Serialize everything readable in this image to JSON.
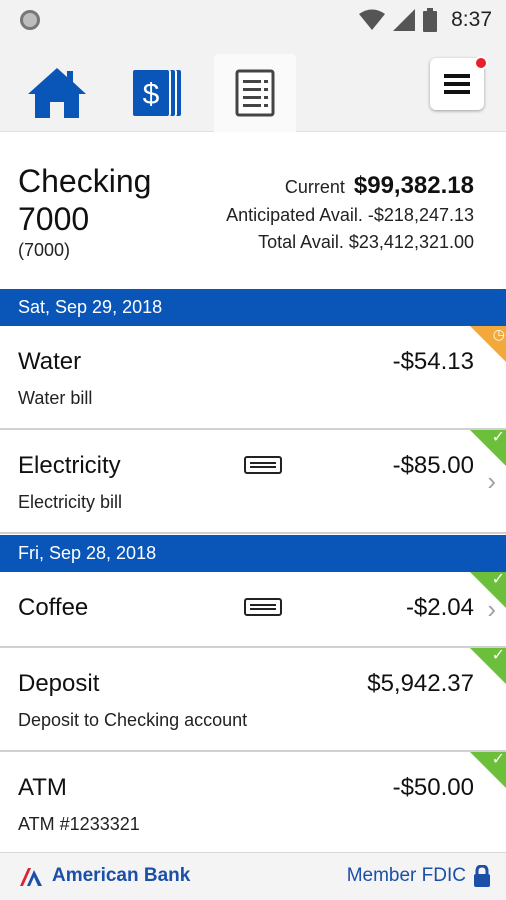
{
  "status_bar": {
    "time": "8:37"
  },
  "nav": {
    "tabs": [
      {
        "icon": "home-icon",
        "active": false
      },
      {
        "icon": "dollar-icon",
        "active": false
      },
      {
        "icon": "statement-icon",
        "active": true
      }
    ],
    "menu": {
      "icon": "hamburger-icon",
      "has_notification": true
    }
  },
  "account": {
    "name": "Checking 7000",
    "number": "(7000)",
    "current_label": "Current",
    "current_value": "$99,382.18",
    "anticipated_label": "Anticipated Avail.",
    "anticipated_value": "-$218,247.13",
    "total_label": "Total Avail.",
    "total_value": "$23,412,321.00"
  },
  "groups": [
    {
      "date": "Sat, Sep 29, 2018",
      "transactions": [
        {
          "title": "Water",
          "amount": "-$54.13",
          "description": "Water bill",
          "status": "pending"
        },
        {
          "title": "Electricity",
          "amount": "-$85.00",
          "description": "Electricity bill",
          "status": "cleared",
          "card": true
        }
      ]
    },
    {
      "date": "Fri, Sep 28, 2018",
      "transactions": [
        {
          "title": "Coffee",
          "amount": "-$2.04",
          "description": "",
          "status": "cleared",
          "card": true
        },
        {
          "title": "Deposit",
          "amount": "$5,942.37",
          "description": "Deposit to Checking account",
          "status": "cleared"
        },
        {
          "title": "ATM",
          "amount": "-$50.00",
          "description": "ATM #1233321",
          "status": "cleared"
        }
      ]
    }
  ],
  "footer": {
    "brand": "American Bank",
    "fdic": "Member FDIC"
  },
  "colors": {
    "brand_blue": "#0a56b8",
    "cleared": "#6bbf3a",
    "pending": "#f2a83a",
    "notification": "#e8202a"
  }
}
